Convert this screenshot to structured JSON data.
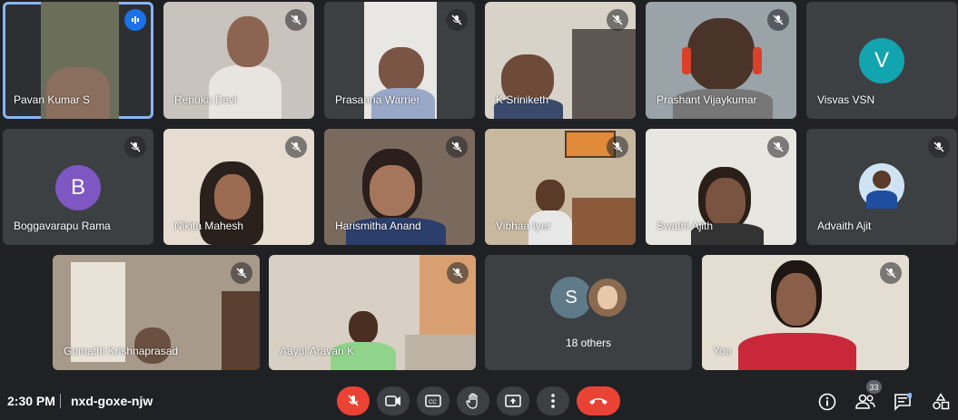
{
  "meeting": {
    "time": "2:30 PM",
    "code": "nxd-goxe-njw"
  },
  "participants": [
    {
      "name": "Pavan Kumar S"
    },
    {
      "name": "Renuka Devi"
    },
    {
      "name": "Prasanna Warrier"
    },
    {
      "name": "K Sriniketh"
    },
    {
      "name": "Prashant Vijaykumar"
    },
    {
      "name": "Visvas VSN",
      "initial": "V"
    },
    {
      "name": "Boggavarapu Rama",
      "initial": "B"
    },
    {
      "name": "Nikita Mahesh"
    },
    {
      "name": "Harismitha Anand"
    },
    {
      "name": "Vibhaa Iyer"
    },
    {
      "name": "Swathi Ajith"
    },
    {
      "name": "Advaith Ajit"
    },
    {
      "name": "Gomathi Krishnaprasad"
    },
    {
      "name": "Aayul Aravan K"
    },
    {
      "name": "You"
    }
  ],
  "others": {
    "label": "18 others",
    "initial": "S"
  },
  "people_count": "33",
  "colors": {
    "accent": "#8ab4f8",
    "danger": "#ea4335",
    "v_avatar": "#12a4af",
    "b_avatar": "#7e57c2",
    "s_avatar": "#5f7b8a"
  }
}
